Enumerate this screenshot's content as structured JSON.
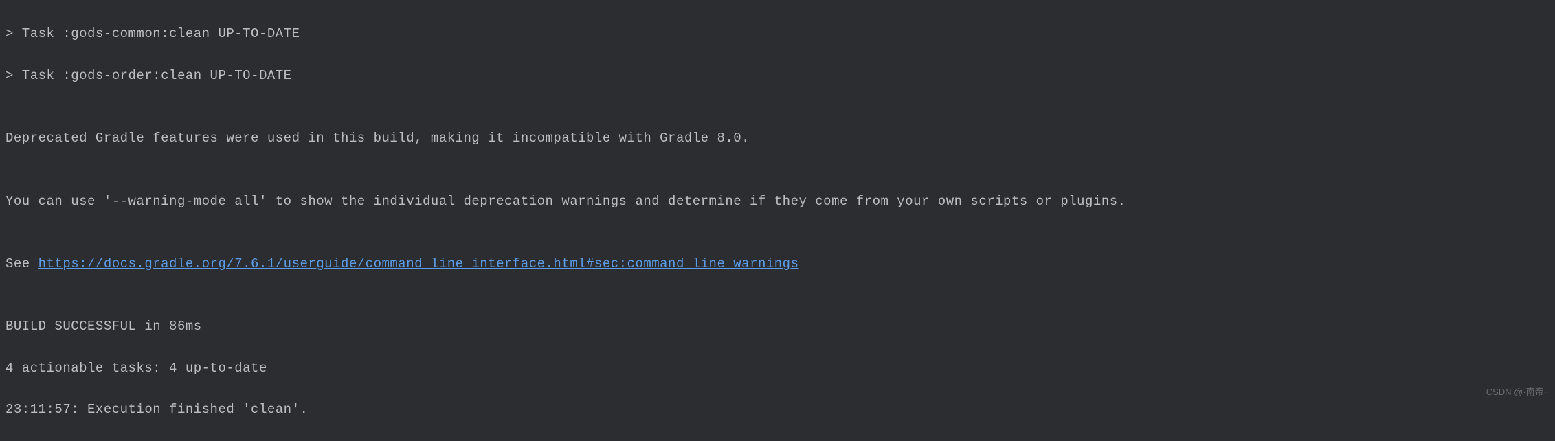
{
  "console": {
    "lines": [
      "> Task :gods-common:clean UP-TO-DATE",
      "> Task :gods-order:clean UP-TO-DATE",
      "",
      "Deprecated Gradle features were used in this build, making it incompatible with Gradle 8.0.",
      "",
      "You can use '--warning-mode all' to show the individual deprecation warnings and determine if they come from your own scripts or plugins.",
      ""
    ],
    "see_prefix": "See ",
    "link_text": "https://docs.gradle.org/7.6.1/userguide/command_line_interface.html#sec:command_line_warnings",
    "lines_after": [
      "",
      "BUILD SUCCESSFUL in 86ms",
      "4 actionable tasks: 4 up-to-date",
      "23:11:57: Execution finished 'clean'."
    ]
  },
  "watermark": "CSDN @·南帝·"
}
